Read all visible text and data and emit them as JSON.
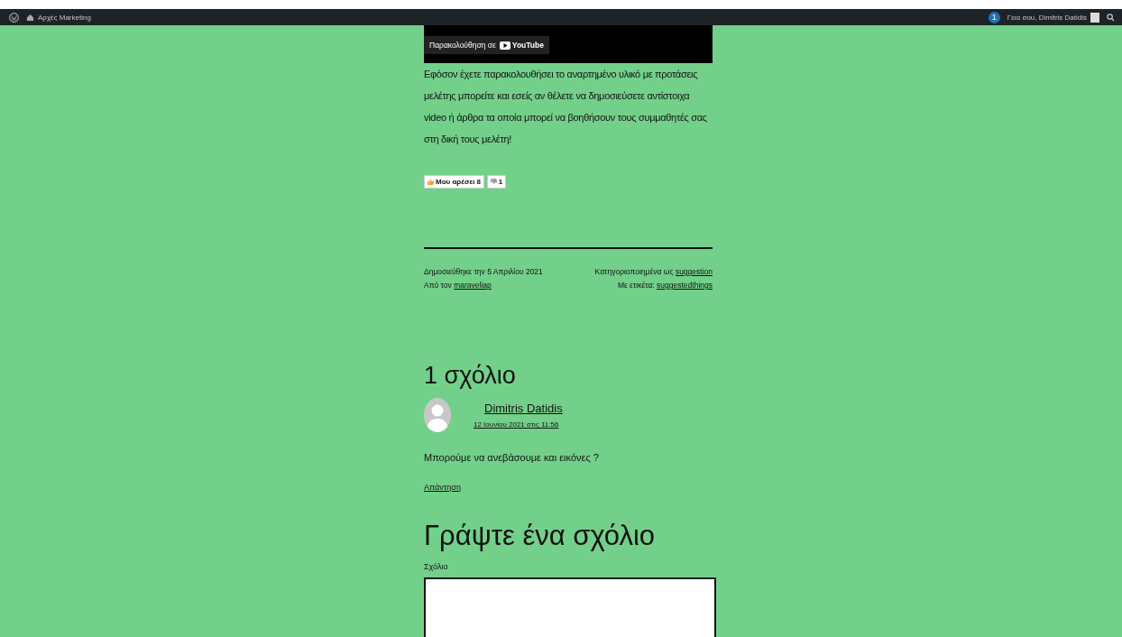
{
  "admin_bar": {
    "site_name": "Αρχές Marketing",
    "notifications": "1",
    "greeting": "Γεια σου, Dimitris Datidis"
  },
  "video": {
    "watch_label": "Παρακολούθηση σε",
    "platform": "YouTube"
  },
  "post": {
    "body": "Εφόσον έχετε παρακολουθήσει το αναρτημένο υλικό με προτάσεις μελέτης μπορείτε και εσείς αν θέλετε να δημοσιεύσετε αντίστοιχα video ή άρθρα τα οποία μπορεί να βοηθήσουν τους συμμαθητές σας στη δική τους μελέτη!",
    "likes": {
      "like_label": "Μου αρέσει",
      "like_count": "8",
      "dislike_count": "1"
    },
    "meta": {
      "published": "Δημοσιεύθηκε την 5 Απριλίου 2021",
      "author_prefix": "Από τον",
      "author": "maraveliap",
      "category_prefix": "Κατηγοριοποιημένα ως",
      "category": "suggestion",
      "tags_prefix": "Με ετικέτα:",
      "tag": "suggestedthings"
    }
  },
  "comments": {
    "title": "1 σχόλιο",
    "items": [
      {
        "author": "Dimitris Datidis",
        "date": "12 Ιουνίου 2021 στις 11:56",
        "text": "Μπορούμε να ανεβάσουμε και εικόνες ?",
        "reply": "Απάντηση"
      }
    ]
  },
  "reply_form": {
    "title": "Γράψτε ένα σχόλιο",
    "field_label": "Σχόλιο"
  }
}
